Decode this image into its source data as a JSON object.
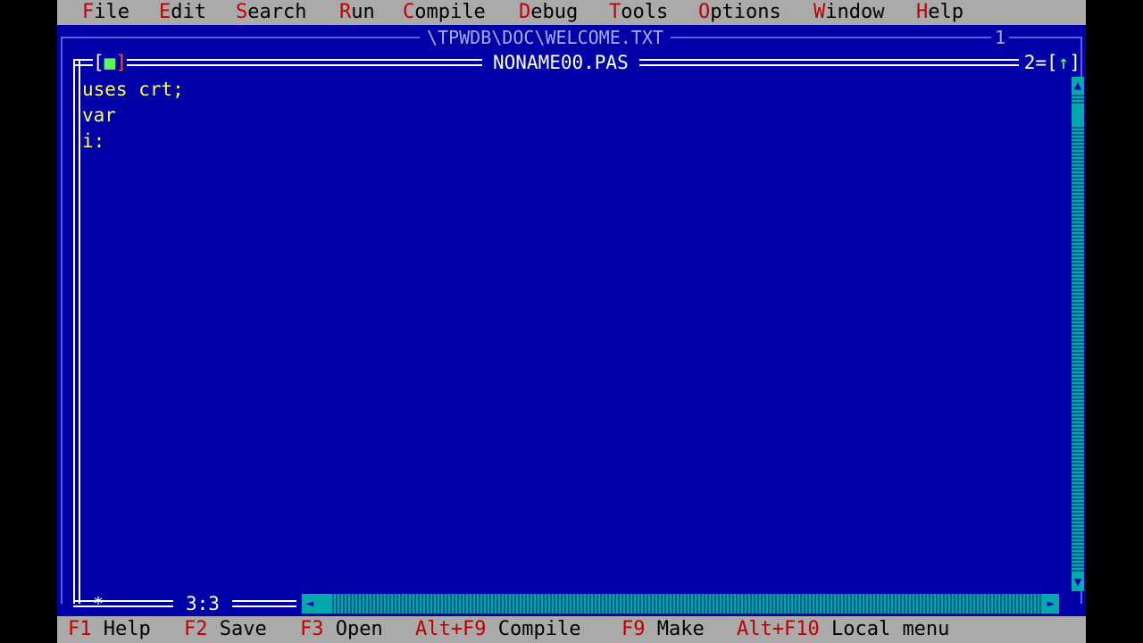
{
  "menu": [
    {
      "hotkey": "F",
      "rest": "ile"
    },
    {
      "hotkey": "E",
      "rest": "dit"
    },
    {
      "hotkey": "S",
      "rest": "earch"
    },
    {
      "hotkey": "R",
      "rest": "un"
    },
    {
      "hotkey": "C",
      "rest": "ompile"
    },
    {
      "hotkey": "D",
      "rest": "ebug"
    },
    {
      "hotkey": "T",
      "rest": "ools"
    },
    {
      "hotkey": "O",
      "rest": "ptions"
    },
    {
      "hotkey": "W",
      "rest": "indow"
    },
    {
      "hotkey": "H",
      "rest": "elp"
    }
  ],
  "back_window": {
    "title": "\\TPWDB\\DOC\\WELCOME.TXT",
    "number": "1"
  },
  "editor_window": {
    "title": "NONAME00.PAS",
    "close_left": "[",
    "close_mark": "■",
    "close_right": "]",
    "zoom_prefix": "2=[",
    "zoom_arrow": "↑",
    "zoom_suffix": "]",
    "position": "3:3",
    "resize_mark": "*"
  },
  "code_lines": [
    "uses crt;",
    "var",
    "i:"
  ],
  "scroll_glyphs": {
    "up": "▲",
    "down": "▼",
    "left": "◄",
    "right": "►"
  },
  "status_bar": [
    {
      "key": "F1",
      "label": "Help"
    },
    {
      "key": "F2",
      "label": "Save"
    },
    {
      "key": "F3",
      "label": "Open"
    },
    {
      "key": "Alt+F9",
      "label": "Compile"
    },
    {
      "key": "F9",
      "label": "Make"
    },
    {
      "key": "Alt+F10",
      "label": "Local menu"
    }
  ],
  "colors": {
    "desktop": "#0000a8",
    "menu_bg": "#aaaaaa",
    "hotkey": "#c00000",
    "code_text": "#ffff55",
    "scrollbar": "#00aaaa"
  }
}
